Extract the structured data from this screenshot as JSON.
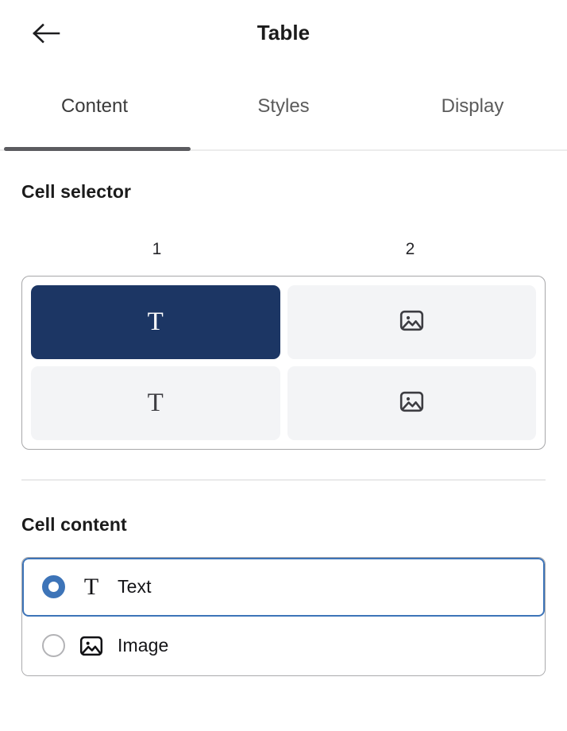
{
  "header": {
    "title": "Table",
    "back_icon": "arrow-left-icon"
  },
  "tabs": [
    {
      "label": "Content",
      "active": true
    },
    {
      "label": "Styles",
      "active": false
    },
    {
      "label": "Display",
      "active": false
    }
  ],
  "cell_selector": {
    "title": "Cell selector",
    "column_headers": [
      "1",
      "2"
    ],
    "cells": [
      {
        "id": "r1c1",
        "content_type": "text",
        "icon": "text-icon",
        "selected": true
      },
      {
        "id": "r1c2",
        "content_type": "image",
        "icon": "image-icon",
        "selected": false
      },
      {
        "id": "r2c1",
        "content_type": "text",
        "icon": "text-icon",
        "selected": false
      },
      {
        "id": "r2c2",
        "content_type": "image",
        "icon": "image-icon",
        "selected": false
      }
    ]
  },
  "cell_content": {
    "title": "Cell content",
    "options": [
      {
        "label": "Text",
        "icon": "text-icon",
        "selected": true
      },
      {
        "label": "Image",
        "icon": "image-icon",
        "selected": false
      }
    ]
  },
  "colors": {
    "selected_cell": "#1c3664",
    "unselected_cell": "#f3f4f6",
    "accent_blue": "#3d74b8",
    "tab_indicator": "#5c5c60",
    "border_gray": "#a7a7a9",
    "text_primary": "#1b1b1b"
  },
  "glyphs": {
    "text": "T"
  }
}
